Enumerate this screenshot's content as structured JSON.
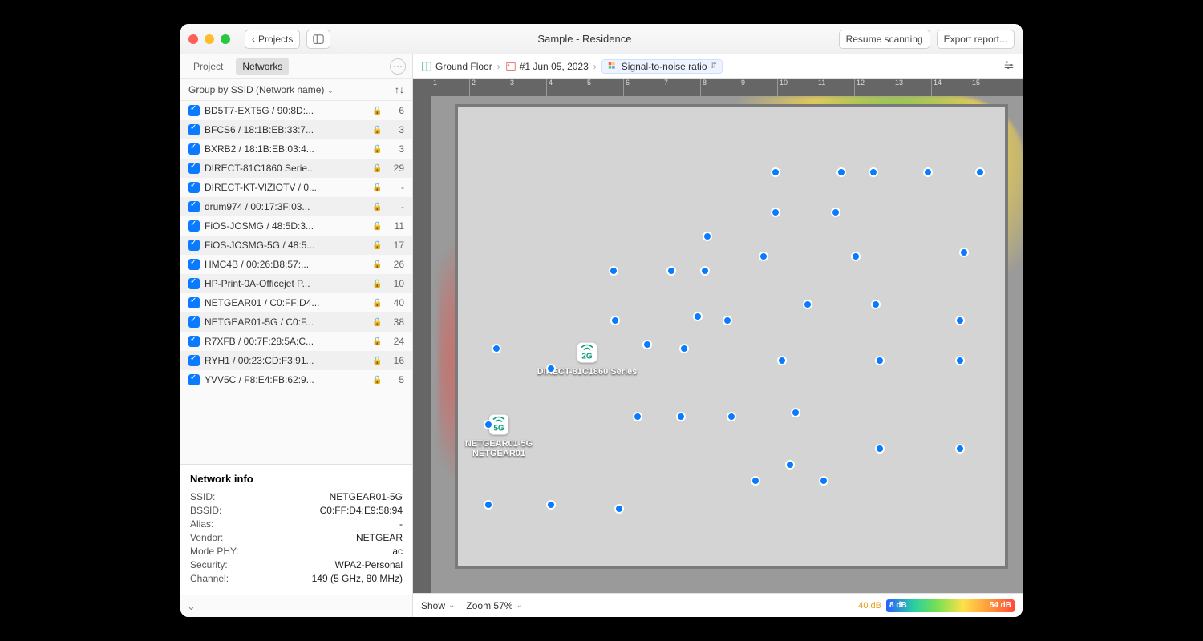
{
  "titlebar": {
    "back_label": "Projects",
    "title": "Sample - Residence",
    "resume_label": "Resume scanning",
    "export_label": "Export report..."
  },
  "sidebar": {
    "tab_project": "Project",
    "tab_networks": "Networks",
    "group_label": "Group by SSID (Network name)",
    "networks": [
      {
        "name": "BD5T7-EXT5G / 90:8D:...",
        "count": "6"
      },
      {
        "name": "BFCS6 / 18:1B:EB:33:7...",
        "count": "3"
      },
      {
        "name": "BXRB2 / 18:1B:EB:03:4...",
        "count": "3"
      },
      {
        "name": "DIRECT-81C1860 Serie...",
        "count": "29"
      },
      {
        "name": "DIRECT-KT-VIZIOTV / 0...",
        "count": "-"
      },
      {
        "name": "drum974 / 00:17:3F:03...",
        "count": "-"
      },
      {
        "name": "FiOS-JOSMG / 48:5D:3...",
        "count": "11"
      },
      {
        "name": "FiOS-JOSMG-5G / 48:5...",
        "count": "17"
      },
      {
        "name": "HMC4B / 00:26:B8:57:...",
        "count": "26"
      },
      {
        "name": "HP-Print-0A-Officejet P...",
        "count": "10"
      },
      {
        "name": "NETGEAR01 / C0:FF:D4...",
        "count": "40"
      },
      {
        "name": "NETGEAR01-5G / C0:F...",
        "count": "38"
      },
      {
        "name": "R7XFB / 00:7F:28:5A:C...",
        "count": "24"
      },
      {
        "name": "RYH1 / 00:23:CD:F3:91...",
        "count": "16"
      },
      {
        "name": "YVV5C / F8:E4:FB:62:9...",
        "count": "5"
      }
    ],
    "info_title": "Network info",
    "info": {
      "ssid_k": "SSID:",
      "ssid_v": "NETGEAR01-5G",
      "bssid_k": "BSSID:",
      "bssid_v": "C0:FF:D4:E9:58:94",
      "alias_k": "Alias:",
      "alias_v": "-",
      "vendor_k": "Vendor:",
      "vendor_v": "NETGEAR",
      "mode_k": "Mode PHY:",
      "mode_v": "ac",
      "security_k": "Security:",
      "security_v": "WPA2-Personal",
      "channel_k": "Channel:",
      "channel_v": "149 (5 GHz, 80 MHz)"
    }
  },
  "breadcrumb": {
    "floor": "Ground Floor",
    "snapshot": "#1 Jun 05, 2023",
    "viz": "Signal-to-noise ratio"
  },
  "ruler": {
    "ticks": [
      "1",
      "2",
      "3",
      "4",
      "5",
      "6",
      "7",
      "8",
      "9",
      "10",
      "11",
      "12",
      "13",
      "14",
      "15"
    ]
  },
  "aps": {
    "ap1_band": "2G",
    "ap1_label": "DIRECT-81C1860 Series",
    "ap2_band": "5G",
    "ap2_label1": "NETGEAR01-5G",
    "ap2_label2": "NETGEAR01"
  },
  "footer": {
    "show": "Show",
    "zoom": "Zoom 57%",
    "legend_left": "40 dB",
    "legend_min": "8 dB",
    "legend_max": "54 dB"
  }
}
